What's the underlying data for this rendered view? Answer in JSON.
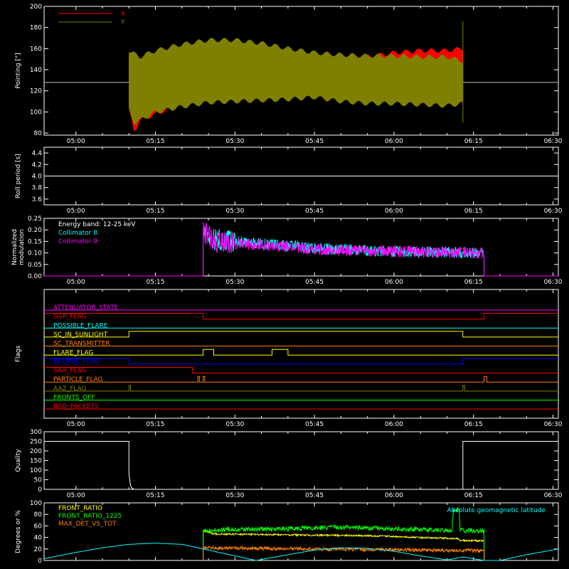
{
  "colors": {
    "x": "#ff0000",
    "y": "#808000",
    "white": "#ffffff",
    "cyan": "#00ffff",
    "magenta": "#ff00ff",
    "yellow": "#ffff00",
    "orange": "#ff8000",
    "green": "#00ff00",
    "blue": "#0000ff",
    "red": "#ff0000",
    "olive": "#808000"
  },
  "time_axis": {
    "ticks": [
      "05:00",
      "05:15",
      "05:30",
      "05:45",
      "06:00",
      "06:15",
      "06:30"
    ],
    "tick_minutes": [
      0,
      15,
      30,
      45,
      60,
      75,
      90
    ],
    "range_minutes": [
      -6,
      91
    ]
  },
  "chart_data": [
    {
      "id": "pointing",
      "type": "line",
      "ylabel": "Pointing [\"]",
      "ylim": [
        78,
        200
      ],
      "yticks": [
        80,
        100,
        120,
        140,
        160,
        180,
        200
      ],
      "reference_level": 128,
      "span_minutes": [
        10,
        73
      ],
      "legend": [
        "X",
        "Y"
      ],
      "series": [
        {
          "name": "X",
          "color": "#ff0000",
          "upper_envelope": [
            [
              10,
              160
            ],
            [
              12,
              140
            ],
            [
              15,
              145
            ],
            [
              20,
              150
            ],
            [
              25,
              150
            ],
            [
              30,
              145
            ],
            [
              40,
              138
            ],
            [
              45,
              140
            ],
            [
              50,
              148
            ],
            [
              55,
              154
            ],
            [
              60,
              158
            ],
            [
              65,
              160
            ],
            [
              70,
              160
            ],
            [
              73,
              162
            ]
          ],
          "lower_envelope": [
            [
              10,
              100
            ],
            [
              11,
              80
            ],
            [
              12,
              90
            ],
            [
              15,
              96
            ],
            [
              20,
              106
            ],
            [
              25,
              112
            ],
            [
              30,
              116
            ],
            [
              40,
              117
            ],
            [
              50,
              118
            ],
            [
              60,
              118
            ],
            [
              70,
              118
            ],
            [
              73,
              118
            ]
          ]
        },
        {
          "name": "Y",
          "color": "#808000",
          "upper_envelope": [
            [
              10,
              160
            ],
            [
              12,
              154
            ],
            [
              15,
              160
            ],
            [
              20,
              166
            ],
            [
              25,
              170
            ],
            [
              30,
              170
            ],
            [
              35,
              167
            ],
            [
              40,
              162
            ],
            [
              45,
              158
            ],
            [
              50,
              156
            ],
            [
              55,
              155
            ],
            [
              60,
              155
            ],
            [
              65,
              154
            ],
            [
              70,
              154
            ],
            [
              73,
              150
            ]
          ],
          "lower_envelope": [
            [
              10,
              100
            ],
            [
              11,
              88
            ],
            [
              12,
              90
            ],
            [
              15,
              98
            ],
            [
              20,
              103
            ],
            [
              25,
              107
            ],
            [
              30,
              108
            ],
            [
              35,
              109
            ],
            [
              40,
              110
            ],
            [
              45,
              112
            ],
            [
              50,
              108
            ],
            [
              55,
              106
            ],
            [
              60,
              106
            ],
            [
              65,
              105
            ],
            [
              70,
              104
            ],
            [
              73,
              106
            ]
          ]
        }
      ]
    },
    {
      "id": "roll",
      "type": "line",
      "ylabel": "Roll period [s]",
      "ylim": [
        3.5,
        4.5
      ],
      "yticks": [
        3.6,
        3.8,
        4.0,
        4.2,
        4.4
      ],
      "series": [
        {
          "color": "#ffffff",
          "points": [
            [
              -6,
              4.0
            ],
            [
              91,
              4.0
            ]
          ]
        }
      ]
    },
    {
      "id": "modulation",
      "type": "line",
      "ylabel": [
        "Normalized",
        "modulation"
      ],
      "ylim": [
        0,
        0.25
      ],
      "yticks": [
        0.0,
        0.05,
        0.1,
        0.15,
        0.2,
        0.25
      ],
      "legend_title": "Energy band: 12-25 keV",
      "span_minutes": [
        24,
        77
      ],
      "series": [
        {
          "name": "Collimator 8",
          "color": "#00ffff",
          "trend": [
            [
              24,
              0.2
            ],
            [
              26,
              0.16
            ],
            [
              30,
              0.15
            ],
            [
              35,
              0.14
            ],
            [
              40,
              0.13
            ],
            [
              45,
              0.12
            ],
            [
              55,
              0.11
            ],
            [
              65,
              0.105
            ],
            [
              77,
              0.1
            ]
          ]
        },
        {
          "name": "Collimator 9",
          "color": "#ff00ff",
          "trend": [
            [
              24,
              0.2
            ],
            [
              26,
              0.15
            ],
            [
              30,
              0.14
            ],
            [
              35,
              0.135
            ],
            [
              40,
              0.125
            ],
            [
              45,
              0.115
            ],
            [
              55,
              0.11
            ],
            [
              65,
              0.105
            ],
            [
              77,
              0.1
            ]
          ]
        }
      ]
    },
    {
      "id": "flags",
      "type": "line",
      "ylabel": "Flags",
      "flags": [
        {
          "label": "ATTENUATOR_STATE",
          "color": "#ff00ff",
          "steps": [
            [
              -6,
              0
            ],
            [
              91,
              0
            ]
          ]
        },
        {
          "label": "GAP_FLAG",
          "color": "#ff0000",
          "steps": [
            [
              -6,
              1
            ],
            [
              24,
              1
            ],
            [
              24,
              0
            ],
            [
              77,
              0
            ],
            [
              77,
              1
            ],
            [
              91,
              1
            ]
          ]
        },
        {
          "label": "POSSIBLE_FLARE",
          "color": "#00ffff",
          "steps": [
            [
              -6,
              0
            ],
            [
              91,
              0
            ]
          ]
        },
        {
          "label": "SC_IN_SUNLIGHT",
          "color": "#ffff00",
          "steps": [
            [
              -6,
              0
            ],
            [
              10,
              0
            ],
            [
              10,
              1
            ],
            [
              73,
              1
            ],
            [
              73,
              0
            ],
            [
              91,
              0
            ]
          ]
        },
        {
          "label": "SC_TRANSMITTER",
          "color": "#ff8000",
          "steps": [
            [
              -6,
              0
            ],
            [
              91,
              0
            ]
          ]
        },
        {
          "label": "FLARE_FLAG",
          "color": "#ffff00",
          "steps": [
            [
              -6,
              0
            ],
            [
              24,
              0
            ],
            [
              24,
              1
            ],
            [
              26,
              1
            ],
            [
              26,
              0
            ],
            [
              37,
              0
            ],
            [
              37,
              1
            ],
            [
              40,
              1
            ],
            [
              40,
              0
            ],
            [
              91,
              0
            ]
          ]
        },
        {
          "label": "ECLIPSE_FLAG",
          "color": "#0000ff",
          "steps": [
            [
              -6,
              1
            ],
            [
              10,
              1
            ],
            [
              10,
              0
            ],
            [
              73,
              0
            ],
            [
              73,
              1
            ],
            [
              91,
              1
            ]
          ]
        },
        {
          "label": "SAA_FLAG",
          "color": "#ff0000",
          "steps": [
            [
              -6,
              1
            ],
            [
              22,
              1
            ],
            [
              22,
              0
            ],
            [
              91,
              0
            ]
          ]
        },
        {
          "label": "PARTICLE_FLAG",
          "color": "#ff8000",
          "steps": [
            [
              -6,
              0
            ],
            [
              23,
              0
            ],
            [
              23,
              1
            ],
            [
              23.3,
              1
            ],
            [
              23.3,
              0
            ],
            [
              24,
              0
            ],
            [
              24,
              1
            ],
            [
              24.3,
              1
            ],
            [
              24.3,
              0
            ],
            [
              77,
              0
            ],
            [
              77,
              1
            ],
            [
              77.5,
              1
            ],
            [
              77.5,
              0
            ],
            [
              91,
              0
            ]
          ]
        },
        {
          "label": "AAZ_FLAG",
          "color": "#808000",
          "steps": [
            [
              -6,
              0
            ],
            [
              10,
              0
            ],
            [
              10,
              1
            ],
            [
              10.3,
              1
            ],
            [
              10.3,
              0
            ],
            [
              73,
              0
            ],
            [
              73,
              1
            ],
            [
              73.3,
              1
            ],
            [
              73.3,
              0
            ],
            [
              91,
              0
            ]
          ]
        },
        {
          "label": "FRONTS_OFF",
          "color": "#00ff00",
          "steps": [
            [
              -6,
              0
            ],
            [
              91,
              0
            ]
          ]
        },
        {
          "label": "BAD_PACKETS",
          "color": "#ff0000",
          "steps": [
            [
              -6,
              0
            ],
            [
              91,
              0
            ]
          ]
        }
      ]
    },
    {
      "id": "quality",
      "type": "line",
      "ylabel": "Quality",
      "ylim": [
        0,
        300
      ],
      "yticks": [
        0,
        50,
        100,
        150,
        200,
        250,
        300
      ],
      "series": [
        {
          "color": "#ffffff",
          "points": [
            [
              -6,
              250
            ],
            [
              10,
              250
            ],
            [
              10,
              80
            ],
            [
              10.3,
              20
            ],
            [
              10.6,
              5
            ],
            [
              11,
              0
            ],
            [
              73,
              0
            ],
            [
              73,
              250
            ],
            [
              91,
              250
            ]
          ]
        }
      ]
    },
    {
      "id": "ratios",
      "type": "line",
      "ylabel": "Degrees or %",
      "ylim": [
        0,
        100
      ],
      "yticks": [
        0,
        20,
        40,
        60,
        80,
        100
      ],
      "annotation": "Absolute geomagnetic latitude",
      "series": [
        {
          "name": "FRONT_RATIO",
          "color": "#ffff00",
          "trend": [
            [
              24,
              52
            ],
            [
              26,
              46
            ],
            [
              35,
              45
            ],
            [
              45,
              44
            ],
            [
              55,
              43
            ],
            [
              65,
              40
            ],
            [
              72,
              38
            ],
            [
              72.5,
              35
            ],
            [
              77,
              34
            ]
          ]
        },
        {
          "name": "FRONT_RATIO_1225",
          "color": "#00ff00",
          "trend": [
            [
              24,
              52
            ],
            [
              30,
              54
            ],
            [
              40,
              55
            ],
            [
              50,
              58
            ],
            [
              60,
              55
            ],
            [
              70,
              52
            ],
            [
              71,
              52
            ],
            [
              71.2,
              88
            ],
            [
              72.3,
              88
            ],
            [
              72.5,
              52
            ],
            [
              77,
              52
            ]
          ]
        },
        {
          "name": "MAX_DET_VS_TOT",
          "color": "#ff8000",
          "trend": [
            [
              24,
              22
            ],
            [
              35,
              21
            ],
            [
              45,
              20
            ],
            [
              55,
              19
            ],
            [
              65,
              18
            ],
            [
              77,
              17
            ]
          ]
        },
        {
          "name": "Absolute geomagnetic latitude",
          "color": "#00ffff",
          "points": [
            [
              -6,
              3
            ],
            [
              0,
              14
            ],
            [
              5,
              22
            ],
            [
              10,
              28
            ],
            [
              15,
              30
            ],
            [
              20,
              28
            ],
            [
              25,
              18
            ],
            [
              30,
              8
            ],
            [
              34,
              0
            ],
            [
              40,
              10
            ],
            [
              45,
              18
            ],
            [
              50,
              22
            ],
            [
              55,
              21
            ],
            [
              60,
              16
            ],
            [
              65,
              8
            ],
            [
              70,
              1
            ],
            [
              73,
              6
            ],
            [
              77,
              0
            ],
            [
              80,
              0
            ],
            [
              85,
              10
            ],
            [
              91,
              20
            ]
          ]
        }
      ]
    }
  ]
}
